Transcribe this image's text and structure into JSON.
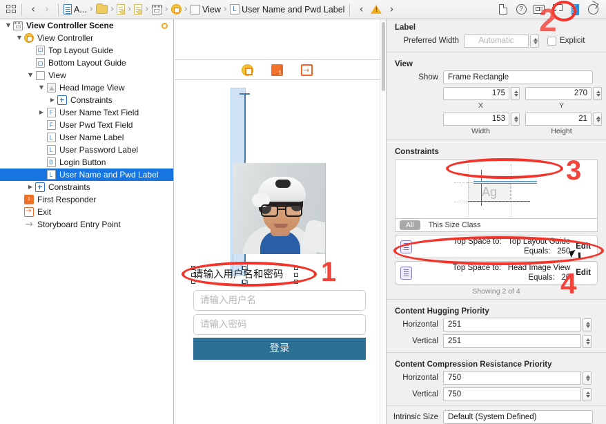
{
  "topbar": {
    "assistant_icon": "grid-icon",
    "back_arrow": "‹",
    "forward_arrow": "›",
    "breadcrumb": [
      {
        "icon": "project-document-icon",
        "label": "A..."
      },
      {
        "icon": "folder-icon",
        "label": ""
      },
      {
        "icon": "storyboard-document-icon",
        "label": ""
      },
      {
        "icon": "storyboard-document-icon",
        "label": ""
      },
      {
        "icon": "scene-icon",
        "label": ""
      },
      {
        "icon": "view-controller-icon",
        "label": ""
      },
      {
        "icon": "view-icon",
        "label": "View"
      },
      {
        "icon": "label-icon",
        "label": "User Name and Pwd Label"
      }
    ],
    "warning_icon": "warning-triangle-icon",
    "inspector_icons": [
      "file-inspector-icon",
      "quick-help-inspector-icon",
      "identity-inspector-icon",
      "attributes-inspector-icon",
      "size-inspector-icon",
      "connections-inspector-icon"
    ]
  },
  "navigator": {
    "items": [
      {
        "label": "View Controller Scene",
        "icon": "scene-icon",
        "indent": 0,
        "twisty": "down",
        "bold": true,
        "selected": false,
        "badge": "unsaved-dot"
      },
      {
        "label": "View Controller",
        "icon": "view-controller-icon",
        "indent": 1,
        "twisty": "down",
        "bold": false,
        "selected": false
      },
      {
        "label": "Top Layout Guide",
        "icon": "top-layout-guide-icon",
        "indent": 2,
        "twisty": "none",
        "bold": false,
        "selected": false
      },
      {
        "label": "Bottom Layout Guide",
        "icon": "bottom-layout-guide-icon",
        "indent": 2,
        "twisty": "none",
        "bold": false,
        "selected": false
      },
      {
        "label": "View",
        "icon": "view-icon",
        "indent": 2,
        "twisty": "down",
        "bold": false,
        "selected": false
      },
      {
        "label": "Head Image View",
        "icon": "image-view-icon",
        "indent": 3,
        "twisty": "down",
        "bold": false,
        "selected": false
      },
      {
        "label": "Constraints",
        "icon": "constraints-icon",
        "indent": 4,
        "twisty": "right",
        "bold": false,
        "selected": false
      },
      {
        "label": "User Name Text Field",
        "icon": "text-field-icon",
        "indent": 3,
        "twisty": "right",
        "bold": false,
        "selected": false
      },
      {
        "label": "User Pwd Text Field",
        "icon": "text-field-icon",
        "indent": 3,
        "twisty": "none",
        "bold": false,
        "selected": false
      },
      {
        "label": "User Name Label",
        "icon": "label-icon",
        "indent": 3,
        "twisty": "none",
        "bold": false,
        "selected": false
      },
      {
        "label": "User Password Label",
        "icon": "label-icon",
        "indent": 3,
        "twisty": "none",
        "bold": false,
        "selected": false
      },
      {
        "label": "Login Button",
        "icon": "button-icon",
        "indent": 3,
        "twisty": "none",
        "bold": false,
        "selected": false
      },
      {
        "label": "User Name and Pwd Label",
        "icon": "label-icon",
        "indent": 3,
        "twisty": "none",
        "bold": false,
        "selected": true
      },
      {
        "label": "Constraints",
        "icon": "constraints-icon",
        "indent": 3,
        "twisty": "right",
        "bold": false,
        "selected": false
      },
      {
        "label": "First Responder",
        "icon": "first-responder-icon",
        "indent": 1,
        "twisty": "none",
        "bold": false,
        "selected": false
      },
      {
        "label": "Exit",
        "icon": "exit-icon",
        "indent": 1,
        "twisty": "none",
        "bold": false,
        "selected": false
      },
      {
        "label": "Storyboard Entry Point",
        "icon": "entry-point-arrow-icon",
        "indent": 1,
        "twisty": "none",
        "bold": false,
        "selected": false
      }
    ]
  },
  "canvas": {
    "dock_icons": [
      "view-controller-icon",
      "first-responder-icon",
      "exit-icon"
    ],
    "selected_label_text": "请输入用户名和密码",
    "username_field_placeholder": "请输入用户名",
    "password_field_placeholder": "请输入密码",
    "login_button_label": "登录",
    "login_button_color": "#2d7095",
    "image_view_alt": "head-photo"
  },
  "inspector": {
    "label_section": {
      "title": "Label",
      "preferred_width_label": "Preferred Width",
      "preferred_width_placeholder": "Automatic",
      "preferred_width_value": "",
      "explicit_label": "Explicit",
      "explicit_checked": false
    },
    "view_section": {
      "title": "View",
      "show_label": "Show",
      "show_value": "Frame Rectangle",
      "x_value": "175",
      "y_value": "270",
      "width_value": "153",
      "height_value": "21",
      "x_label": "X",
      "y_label": "Y",
      "width_label": "Width",
      "height_label": "Height"
    },
    "constraints_section": {
      "title": "Constraints",
      "diagram_sample_text": "Ag",
      "size_class_pill": "All",
      "size_class_text": "This Size Class",
      "items": [
        {
          "relation_label": "Top Space to:",
          "relation_target": "Top Layout Guide",
          "equals_label": "Equals:",
          "equals_value": "250",
          "edit_label": "Edit"
        },
        {
          "relation_label": "Top Space to:",
          "relation_target": "Head Image View",
          "equals_label": "Equals:",
          "equals_value": "20",
          "edit_label": "Edit"
        }
      ],
      "showing_text": "Showing 2 of 4"
    },
    "content_hugging": {
      "title": "Content Hugging Priority",
      "horizontal_label": "Horizontal",
      "horizontal_value": "251",
      "vertical_label": "Vertical",
      "vertical_value": "251"
    },
    "compression_resistance": {
      "title": "Content Compression Resistance Priority",
      "horizontal_label": "Horizontal",
      "horizontal_value": "750",
      "vertical_label": "Vertical",
      "vertical_value": "750"
    },
    "intrinsic": {
      "label": "Intrinsic Size",
      "value": "Default (System Defined)"
    }
  },
  "annotations": {
    "color": "#f4433a",
    "markers": [
      {
        "id": "1",
        "target": "canvas-label"
      },
      {
        "id": "2",
        "target": "size-inspector-icon"
      },
      {
        "id": "3",
        "target": "constraints-diagram"
      },
      {
        "id": "4",
        "target": "constraint-row-top-layout-guide"
      }
    ]
  }
}
